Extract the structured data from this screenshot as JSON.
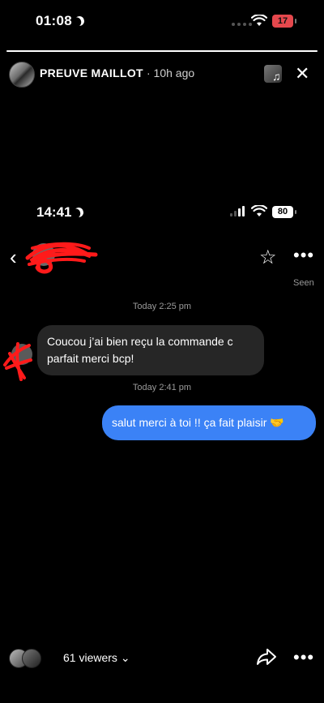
{
  "status_bar": {
    "time": "01:08",
    "battery": "17"
  },
  "story": {
    "progress": 1.0,
    "username": "PREUVE MAILLOT",
    "time_ago": "· 10h ago",
    "music_icon": "music-note-icon",
    "close_icon": "close-icon"
  },
  "screenshot": {
    "status_time": "14:41",
    "battery": "80",
    "seen": "Seen",
    "messages": [
      {
        "timestamp": "Today 2:25 pm",
        "text": "Coucou j’ai bien reçu la commande c parfait merci bcp!",
        "direction": "incoming"
      },
      {
        "timestamp": "Today 2:41 pm",
        "text": "salut merci à toi !! ça fait plaisir 🤝",
        "direction": "outgoing"
      }
    ]
  },
  "footer": {
    "viewers": "61 viewers",
    "chevron": "⌄"
  },
  "colors": {
    "background": "#000000",
    "incoming_bubble": "#262626",
    "outgoing_bubble": "#3b82f6",
    "battery_low": "#e5484d",
    "scribble": "#ff1a1a"
  }
}
